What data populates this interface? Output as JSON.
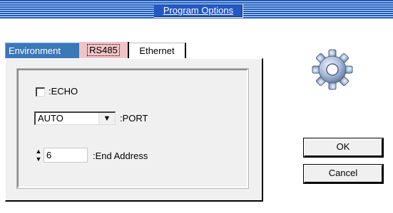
{
  "window": {
    "title": "Program Options"
  },
  "tabs": [
    {
      "label": "Environment"
    },
    {
      "label": "RS485"
    },
    {
      "label": "Ethernet"
    }
  ],
  "rs485": {
    "echo": {
      "label": ":ECHO",
      "checked": false
    },
    "port": {
      "value": "AUTO",
      "label": ":PORT"
    },
    "end_address": {
      "value": "6",
      "label": ":End Address"
    }
  },
  "buttons": {
    "ok": "OK",
    "cancel": "Cancel"
  },
  "icons": {
    "app": "gear-icon",
    "dropdown": "dropdown-arrow-icon",
    "spinner": "spinner-arrows-icon"
  },
  "colors": {
    "titlebar": "#1e5bbd",
    "active_tab": "#f2c3c5",
    "environment_tab": "#3a78b8"
  }
}
